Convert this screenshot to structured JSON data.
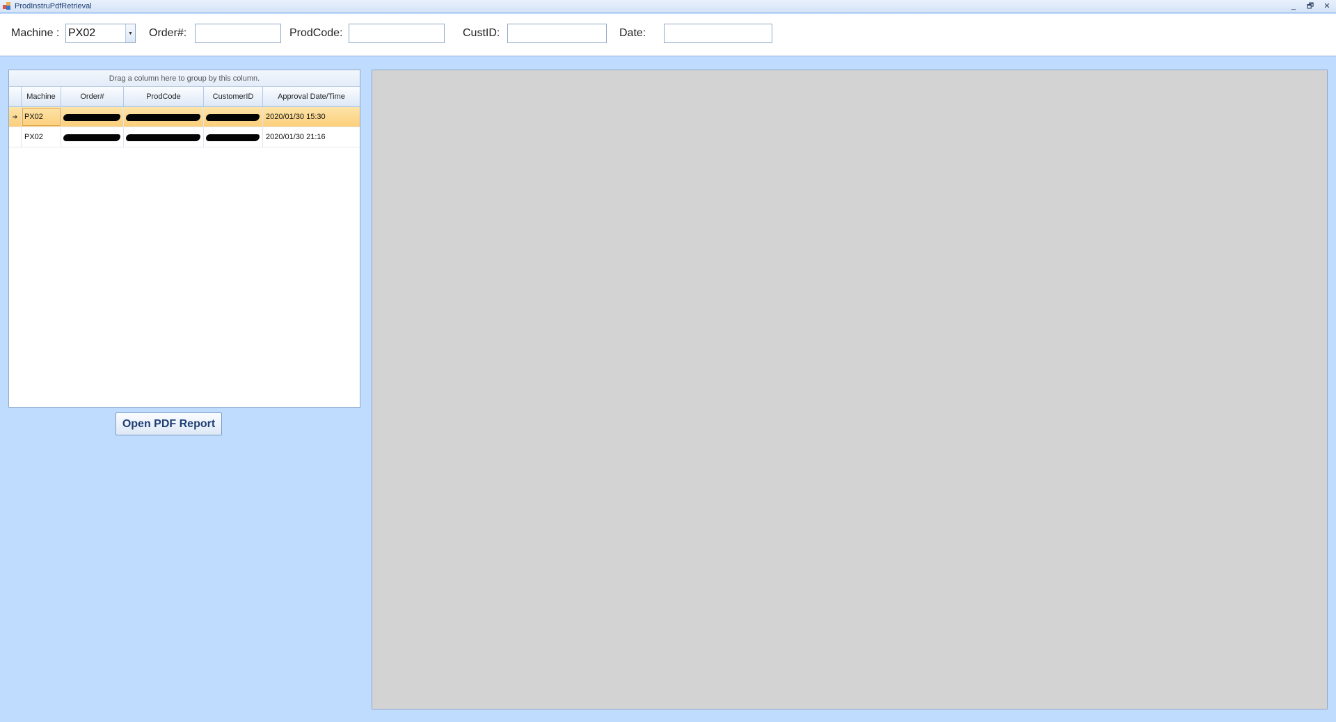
{
  "window": {
    "title": "ProdInstruPdfRetrieval",
    "controls": {
      "minimize": "_",
      "restore": "🗗",
      "close": "✕"
    }
  },
  "filters": {
    "machine_label": "Machine :",
    "machine_value": "PX02",
    "order_label": "Order#:",
    "order_value": "",
    "prodcode_label": "ProdCode:",
    "prodcode_value": "",
    "custid_label": "CustID:",
    "custid_value": "",
    "date_label": "Date:",
    "date_value": ""
  },
  "grid": {
    "group_panel_text": "Drag a column here to group by this column.",
    "columns": [
      "Machine",
      "Order#",
      "ProdCode",
      "CustomerID",
      "Approval Date/Time"
    ],
    "rows": [
      {
        "machine": "PX02",
        "approval": "2020/01/30 15:30",
        "selected": true
      },
      {
        "machine": "PX02",
        "approval": "2020/01/30 21:16",
        "selected": false
      }
    ],
    "row_indicator": "➔"
  },
  "actions": {
    "open_pdf_label": "Open PDF Report"
  },
  "colors": {
    "background": "#bfdbfe",
    "selected_row": "#fbcf7b",
    "viewer": "#d3d3d3"
  }
}
